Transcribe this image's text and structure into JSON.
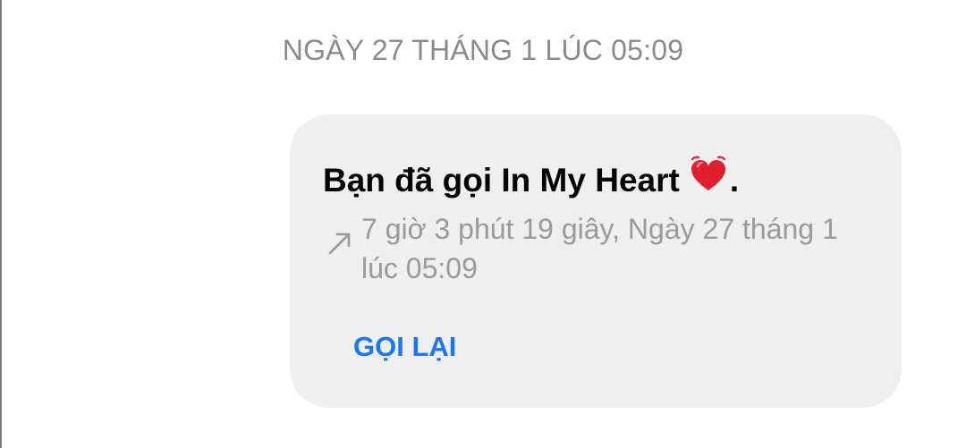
{
  "date_header": "NGÀY 27 THÁNG 1 LÚC 05:09",
  "call": {
    "title_prefix": "Bạn đã gọi In My Heart",
    "title_suffix": ".",
    "heart_icon": "beating-heart-icon",
    "direction_icon": "outgoing-call-arrow-icon",
    "detail": "7 giờ 3 phút 19 giây, Ngày 27 tháng 1 lúc 05:09",
    "callback_label": "GỌI LẠI"
  },
  "colors": {
    "bubble_bg": "#efefef",
    "accent": "#1877f2",
    "muted_text": "#8a8a8a",
    "heart": "#e0202e"
  }
}
